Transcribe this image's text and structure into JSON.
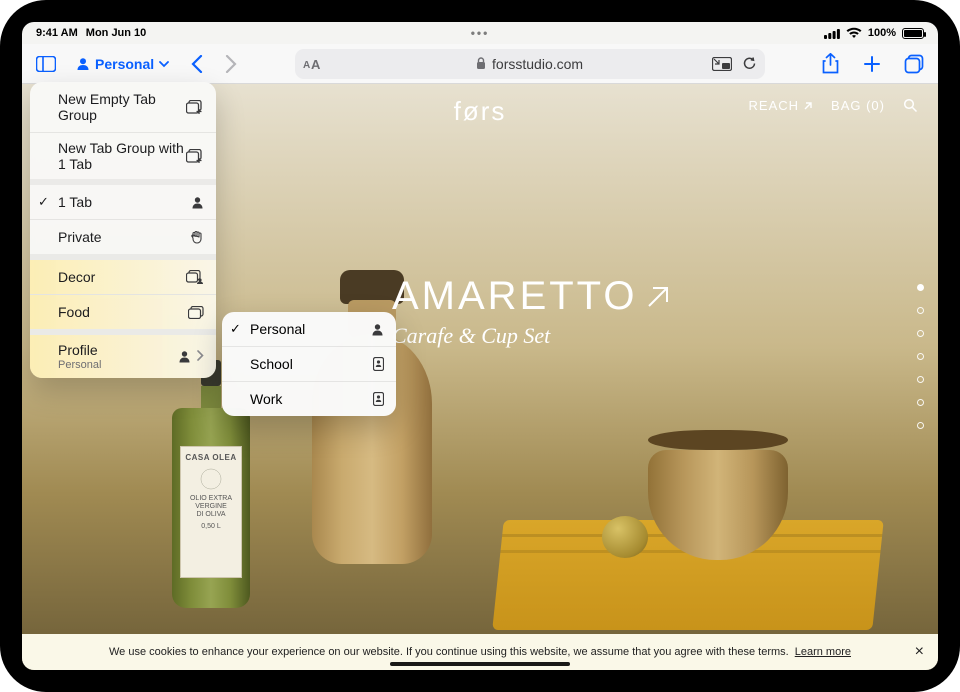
{
  "statusbar": {
    "time": "9:41 AM",
    "date": "Mon Jun 10",
    "battery_pct": "100%"
  },
  "toolbar": {
    "profile_label": "Personal",
    "url": "forsstudio.com"
  },
  "dropdown": {
    "new_empty": "New Empty Tab Group",
    "new_with": "New Tab Group with 1 Tab",
    "one_tab": "1 Tab",
    "private": "Private",
    "groups": [
      "Decor",
      "Food"
    ],
    "profile_label": "Profile",
    "profile_current": "Personal"
  },
  "profile_submenu": {
    "items": [
      "Personal",
      "School",
      "Work"
    ],
    "selected": "Personal"
  },
  "site": {
    "logo": "førs",
    "reach": "REACH",
    "bag": "BAG (0)"
  },
  "hero": {
    "title": "AMARETTO",
    "subtitle": "Carafe & Cup Set"
  },
  "bottle_label": {
    "brand": "CASA OLEA",
    "line1": "OLIO EXTRA",
    "line2": "VERGINE",
    "line3": "DI OLIVA",
    "size": "0,50 L"
  },
  "cookies": {
    "text": "We use cookies to enhance your experience on our website. If you continue using this website, we assume that you agree with these terms.",
    "learn": "Learn more"
  }
}
